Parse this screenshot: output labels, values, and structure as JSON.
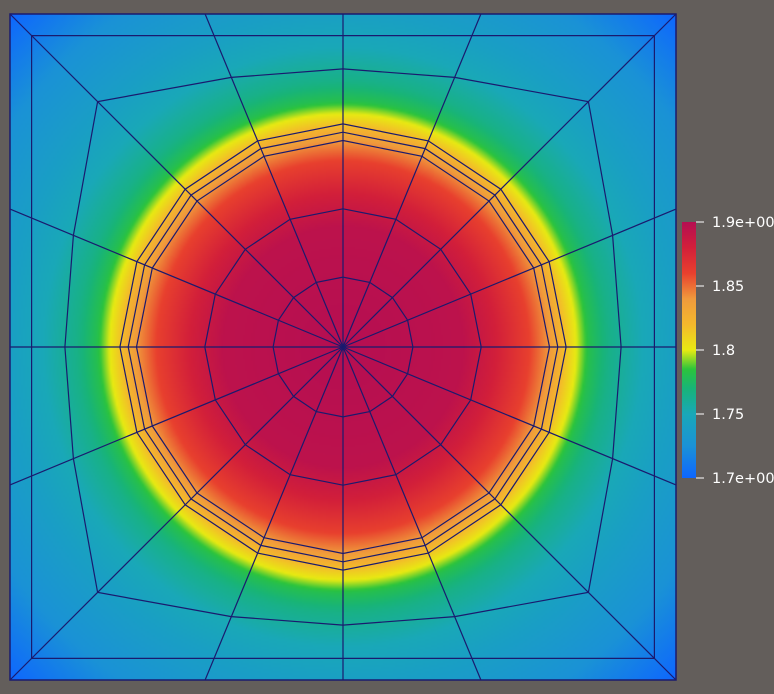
{
  "background_color": "#635e5b",
  "mesh_color": "#1a1a6e",
  "colormap": {
    "min": 1.7,
    "max": 1.9,
    "stops": [
      {
        "value": 1.7,
        "color": "#0e66ff"
      },
      {
        "value": 1.725,
        "color": "#1a92d6"
      },
      {
        "value": 1.75,
        "color": "#19a8b8"
      },
      {
        "value": 1.77,
        "color": "#18b478"
      },
      {
        "value": 1.785,
        "color": "#2cc43c"
      },
      {
        "value": 1.8,
        "color": "#e8ea12"
      },
      {
        "value": 1.82,
        "color": "#f4b82c"
      },
      {
        "value": 1.84,
        "color": "#f09a3c"
      },
      {
        "value": 1.86,
        "color": "#e8402e"
      },
      {
        "value": 1.88,
        "color": "#d21f3a"
      },
      {
        "value": 1.9,
        "color": "#b50e52"
      }
    ],
    "ticks": [
      {
        "value": 1.9,
        "label": "1.9e+00"
      },
      {
        "value": 1.85,
        "label": "1.85"
      },
      {
        "value": 1.8,
        "label": "1.8"
      },
      {
        "value": 1.75,
        "label": "1.75"
      },
      {
        "value": 1.7,
        "label": "1.7e+00"
      }
    ]
  },
  "field": {
    "radial_profile": [
      {
        "r": 0.0,
        "value": 1.9
      },
      {
        "r": 0.36,
        "value": 1.895
      },
      {
        "r": 0.46,
        "value": 1.88
      },
      {
        "r": 0.56,
        "value": 1.86
      },
      {
        "r": 0.62,
        "value": 1.84
      },
      {
        "r": 0.66,
        "value": 1.82
      },
      {
        "r": 0.7,
        "value": 1.8
      },
      {
        "r": 0.74,
        "value": 1.78
      },
      {
        "r": 0.8,
        "value": 1.765
      },
      {
        "r": 0.9,
        "value": 1.75
      },
      {
        "r": 1.0,
        "value": 1.74
      },
      {
        "r": 1.2,
        "value": 1.725
      },
      {
        "r": 1.414,
        "value": 1.7
      }
    ]
  }
}
